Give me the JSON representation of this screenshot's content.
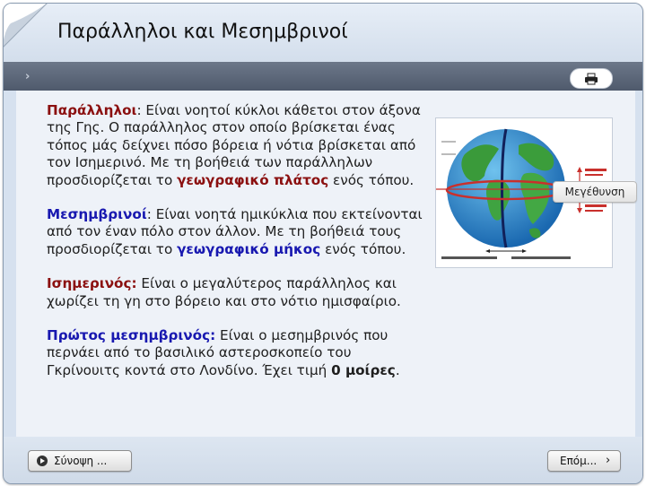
{
  "header": {
    "title": "Παράλληλοι και Μεσημβρινοί"
  },
  "toolbar": {
    "nav_arrow": "›",
    "print_icon": "printer-icon"
  },
  "content": {
    "p1": {
      "term": "Παράλληλοι",
      "text1": ": Είναι νοητοί κύκλοι κάθετοι στον άξονα της Γης. Ο παράλληλος στον οποίο βρίσκεται ένας τόπος μάς δείχνει πόσο βόρεια ή νότια βρίσκεται από τον Ισημερινό. Με τη βοήθειά των παράλληλων προσδιορίζεται το ",
      "highlight": "γεωγραφικό πλάτος",
      "text2": " ενός τόπου."
    },
    "p2": {
      "term": "Μεσημβρινοί",
      "text1": ": Είναι νοητά ημικύκλια που εκτείνονται από τον έναν πόλο στον άλλον. Με τη βοήθειά τους προσδιορίζεται το ",
      "highlight": "γεωγραφικό μήκος",
      "text2": " ενός τόπου."
    },
    "p3": {
      "term": "Ισημερινός:",
      "text1": " Είναι ο μεγαλύτερος παράλληλος και χωρίζει τη γη στο βόρειο και στο νότιο ημισφαίριο."
    },
    "p4": {
      "term": "Πρώτος μεσημβρινός:",
      "text1": " Είναι ο μεσημβρινός που περνάει από το βασιλικό αστεροσκοπείο του Γκρίνουιτς κοντά στο Λονδίνο. Έχει τιμή ",
      "highlight": "0 μοίρες",
      "text2": "."
    }
  },
  "image": {
    "icon": "globe-image"
  },
  "zoom_button": {
    "label": "Μεγέθυνση"
  },
  "footer": {
    "summary_label": "Σύνοψη ...",
    "next_label": "Επόμ...",
    "next_chevron": "›"
  }
}
